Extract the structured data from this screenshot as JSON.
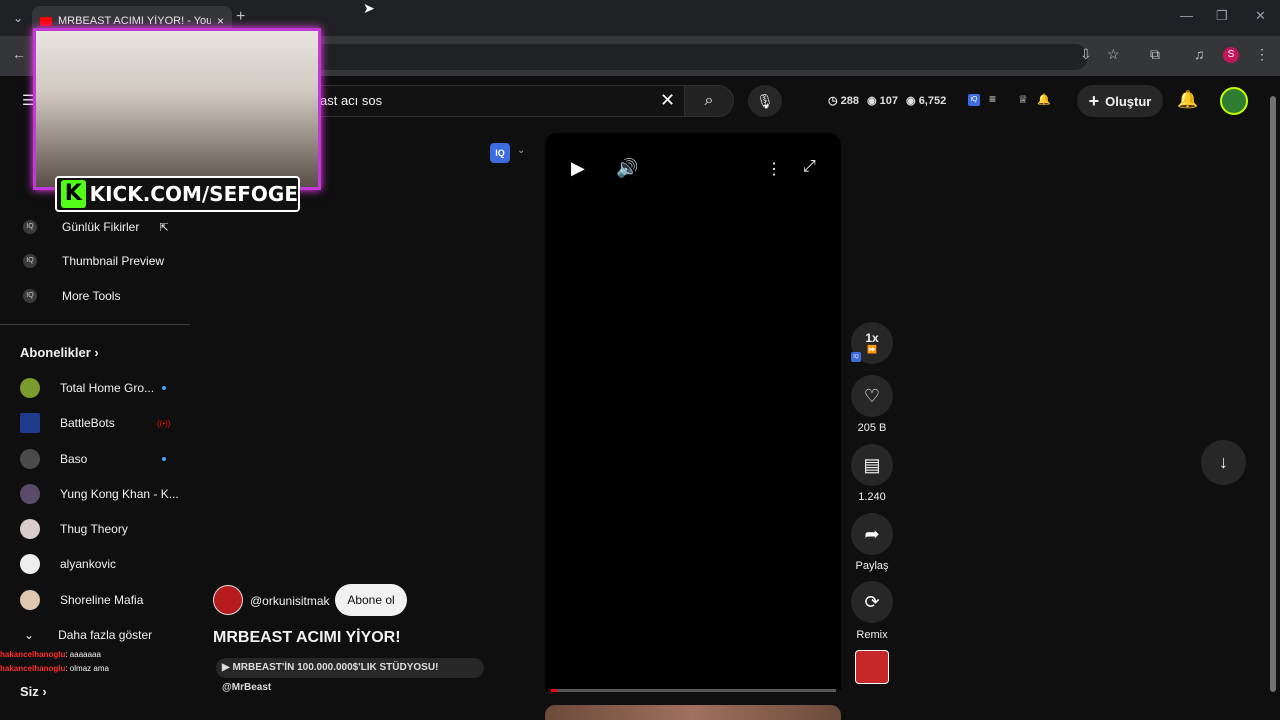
{
  "browser": {
    "tab_title": "MRBEAST ACIMI YİYOR! - YouTube",
    "new_tab": "+",
    "tab_close": "×"
  },
  "search": {
    "query": "ast  acı sos"
  },
  "stats": {
    "a": "288",
    "b": "107",
    "c": "6,752"
  },
  "header": {
    "create_label": "Oluştur"
  },
  "overlay": {
    "kick": "KICK.COM/SEFOGE",
    "k": "K"
  },
  "sidebar": {
    "tools": [
      {
        "label": "Günlük Fikirler",
        "icon": "external-link-icon"
      },
      {
        "label": "Thumbnail Preview"
      },
      {
        "label": "More Tools"
      }
    ],
    "subs_title": "Abonelikler",
    "subs": [
      {
        "label": "Total Home Gro...",
        "color": "#7b9a2f",
        "dot": "#3ea6ff"
      },
      {
        "label": "BattleBots",
        "color": "#1e3a8a",
        "live": "((•))"
      },
      {
        "label": "Baso",
        "color": "#4a4a4a",
        "dot": "#3ea6ff"
      },
      {
        "label": "Yung Kong Khan - K...",
        "color": "#5b4b6a"
      },
      {
        "label": "Thug Theory",
        "color": "#d7ccc8"
      },
      {
        "label": "alyankovic",
        "color": "#eeeeee"
      },
      {
        "label": "Shoreline Mafia",
        "color": "#e0c7b0"
      }
    ],
    "show_more": "Daha fazla göster",
    "you": "Siz"
  },
  "chat": [
    {
      "user": "hakancelhanoglu",
      "msg": ": aaaaaaa"
    },
    {
      "user": "hakancelhanoglu",
      "msg": ": olmaz ama"
    }
  ],
  "video": {
    "channel": "@orkunisitmak",
    "subscribe": "Abone ol",
    "title": "MRBEAST ACIMI YİYOR!",
    "link": "▶ MRBEAST'İN 100.000.000$'LIK STÜDYOSU! @MrBeast",
    "progress": 0.02
  },
  "actions": {
    "speed": "1x",
    "likes": "205 B",
    "comments": "1.240",
    "share": "Paylaş",
    "remix": "Remix"
  },
  "colors": {
    "accent": "#3ea6ff",
    "live": "#ff0000",
    "iq": "#3c6ce0",
    "kick": "#53fc18"
  }
}
